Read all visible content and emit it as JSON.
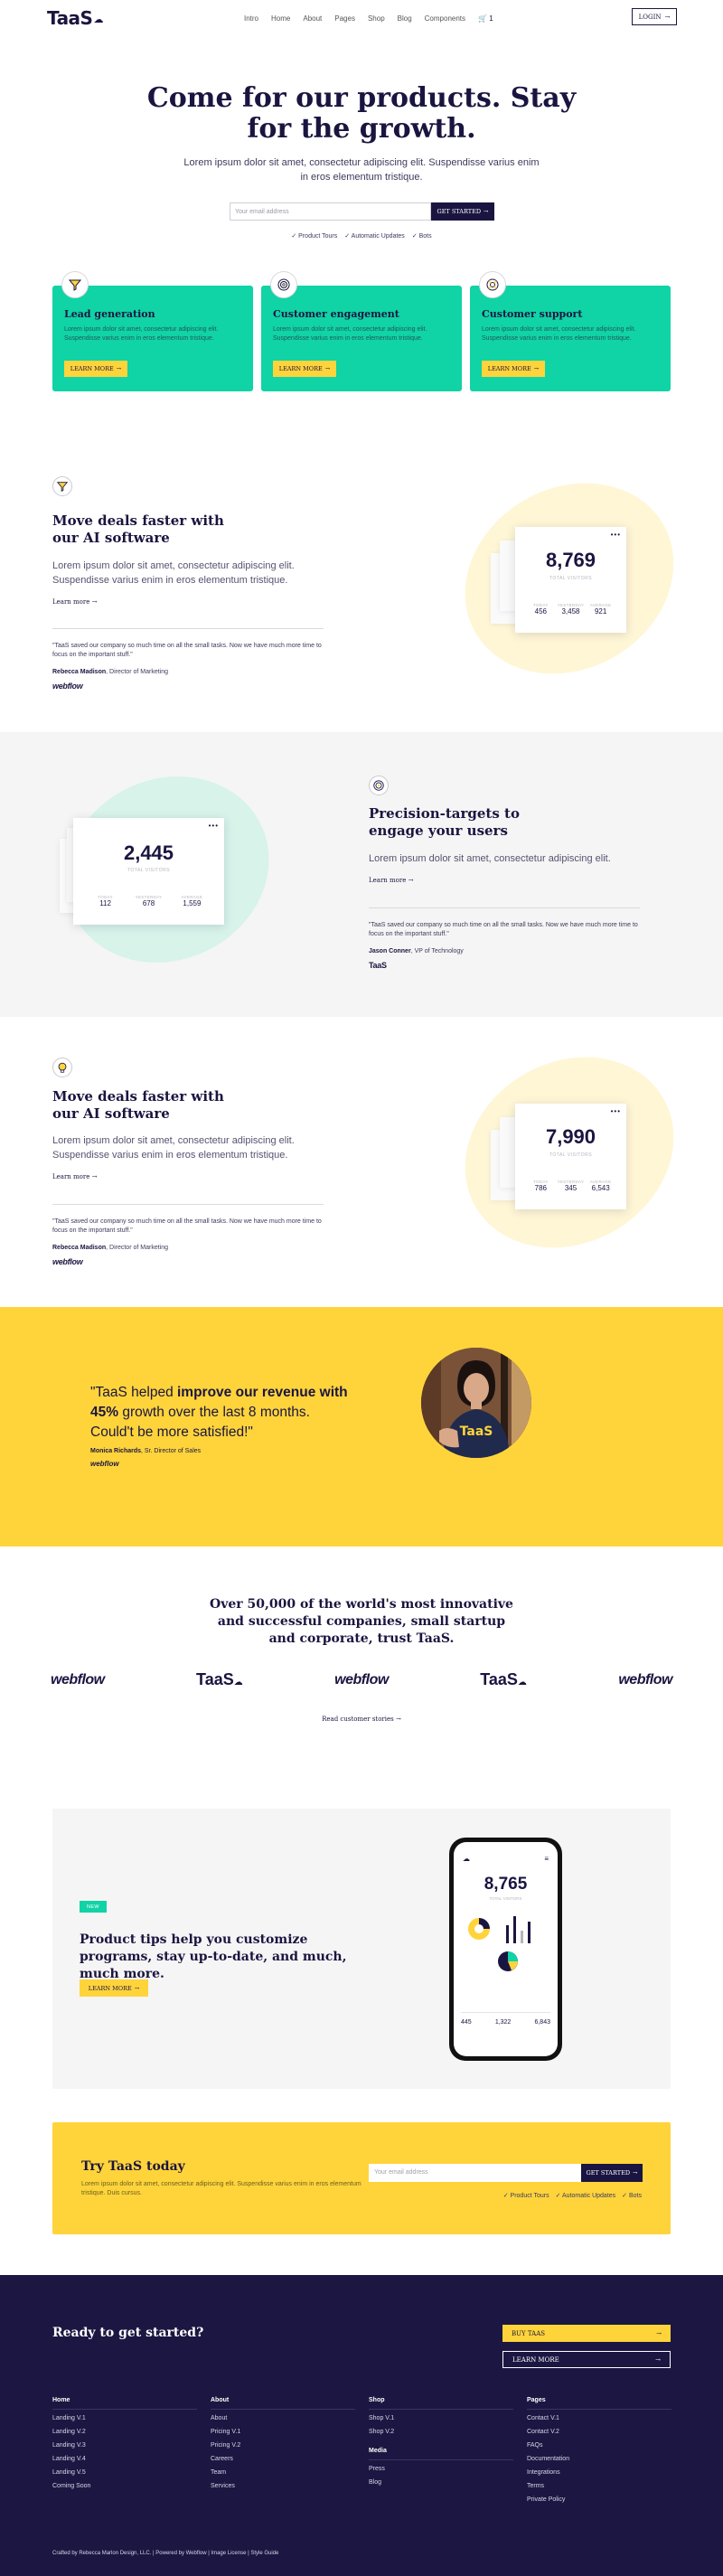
{
  "nav": {
    "logo": "TaaS",
    "links": [
      "Intro",
      "Home",
      "About",
      "Pages",
      "Shop",
      "Blog",
      "Components"
    ],
    "cart_count": "1",
    "login_label": "LOGIN"
  },
  "hero": {
    "title": "Come for our products. Stay for the growth.",
    "subtitle": "Lorem ipsum dolor sit amet, consectetur adipiscing elit. Suspendisse varius enim in eros elementum tristique.",
    "email_placeholder": "Your email address",
    "cta_label": "GET STARTED",
    "checks": [
      "✓ Product Tours",
      "✓ Automatic Updates",
      "✓ Bots"
    ]
  },
  "feature_cards": [
    {
      "title": "Lead generation",
      "desc": "Lorem ipsum dolor sit amet, consectetur adipiscing elit. Suspendisse varius enim in eros elementum tristique.",
      "button": "LEARN MORE",
      "icon": "funnel-icon"
    },
    {
      "title": "Customer engagement",
      "desc": "Lorem ipsum dolor sit amet, consectetur adipiscing elit. Suspendisse varius enim in eros elementum tristique.",
      "button": "LEARN MORE",
      "icon": "target-icon"
    },
    {
      "title": "Customer support",
      "desc": "Lorem ipsum dolor sit amet, consectetur adipiscing elit. Suspendisse varius enim in eros elementum tristique.",
      "button": "LEARN MORE",
      "icon": "lifebuoy-icon"
    }
  ],
  "section1": {
    "title": "Move deals faster with our AI software",
    "desc": "Lorem ipsum dolor sit amet, consectetur adipiscing elit. Suspendisse varius enim in eros elementum tristique.",
    "learn": "Learn more",
    "quote": "\"TaaS saved our company so much time on all the small tasks. Now we have much more time to focus on the important stuff.\"",
    "person": "Rebecca Madison",
    "role": ", Director of Marketing",
    "wordmark": "webflow",
    "stat": {
      "big": "8,769",
      "label": "TOTAL VISITORS",
      "k1": "TODAY",
      "v1": "456",
      "k2": "YESTERDAY",
      "v2": "3,458",
      "k3": "AVERAGE",
      "v3": "921"
    }
  },
  "section2": {
    "title": "Precision-targets to engage your users",
    "desc": "Lorem ipsum dolor sit amet, consectetur adipiscing elit.",
    "learn": "Learn more",
    "quote": "\"TaaS saved our company so much time on all the small tasks. Now we have much more time to focus on the important stuff.\"",
    "person": "Jason Conner",
    "role": ", VP of Technology",
    "wordmark": "TaaS",
    "stat": {
      "big": "2,445",
      "label": "TOTAL VISITORS",
      "k1": "TODAY",
      "v1": "112",
      "k2": "YESTERDAY",
      "v2": "678",
      "k3": "AVERAGE",
      "v3": "1,559"
    }
  },
  "section3": {
    "title": "Move deals faster with our AI software",
    "desc": "Lorem ipsum dolor sit amet, consectetur adipiscing elit. Suspendisse varius enim in eros elementum tristique.",
    "learn": "Learn more",
    "quote": "\"TaaS saved our company so much time on all the small tasks. Now we have much more time to focus on the important stuff.\"",
    "person": "Rebecca Madison",
    "role": ", Director of Marketing",
    "wordmark": "webflow",
    "stat": {
      "big": "7,990",
      "label": "TOTAL VISITORS",
      "k1": "TODAY",
      "v1": "786",
      "k2": "YESTERDAY",
      "v2": "345",
      "k3": "AVERAGE",
      "v3": "6,543"
    }
  },
  "testimonial": {
    "q1": "\"TaaS helped ",
    "q_bold": "improve our revenue with 45%",
    "q2": " growth over the last 8 months. Could't be more satisfied!\"",
    "person": "Monica Richards",
    "role": ", Sr. Director of Sales",
    "wordmark": "webflow",
    "shirt_text": "TaaS"
  },
  "trust": {
    "title": "Over 50,000 of the world's most innovative and successful companies, small startup and corporate, trust TaaS.",
    "logos": [
      "webflow",
      "TaaS",
      "webflow",
      "TaaS",
      "webflow"
    ],
    "read_more": "Read customer stories"
  },
  "tips": {
    "badge": "NEW",
    "title": "Product tips help you customize programs, stay up-to-date, and much, much more.",
    "button": "LEARN MORE",
    "phone": {
      "big": "8,765",
      "label": "TOTAL VISITORS",
      "v1": "445",
      "v2": "1,322",
      "v3": "6,843"
    }
  },
  "try": {
    "title": "Try TaaS today",
    "desc": "Lorem ipsum dolor sit amet, consectetur adipiscing elit. Suspendisse varius enim in eros elementum tristique. Duis cursus.",
    "email_placeholder": "Your email address",
    "cta_label": "GET STARTED",
    "checks": [
      "✓ Product Tours",
      "✓ Automatic Updates",
      "✓ Bots"
    ]
  },
  "footer": {
    "ready": "Ready to get started?",
    "buy": "BUY TAAS",
    "learn": "LEARN MORE",
    "columns": [
      {
        "heading": "Home",
        "links": [
          "Landing V.1",
          "Landing V.2",
          "Landing V.3",
          "Landing V.4",
          "Landing V.5",
          "Coming Soon"
        ]
      },
      {
        "heading": "About",
        "links": [
          "About",
          "Pricing V.1",
          "Pricing V.2",
          "Careers",
          "Team",
          "Services"
        ]
      },
      {
        "heading": "Shop",
        "links": [
          "Shop V.1",
          "Shop V.2"
        ],
        "heading2": "Media",
        "links2": [
          "Press",
          "Blog"
        ]
      },
      {
        "heading": "Pages",
        "links": [
          "Contact V.1",
          "Contact V.2",
          "FAQs",
          "Documentation",
          "Integrations",
          "Terms",
          "Private Policy"
        ]
      }
    ],
    "credit": "Crafted by Rebecca Marlon Design, LLC.  |  Powered by Webflow  |  Image License  |  Style Guide"
  },
  "colors": {
    "navy": "#1a1540",
    "teal": "#10d3a6",
    "yellow": "#ffd43b",
    "footer": "#1c1642",
    "gray": "#f5f5f5"
  }
}
